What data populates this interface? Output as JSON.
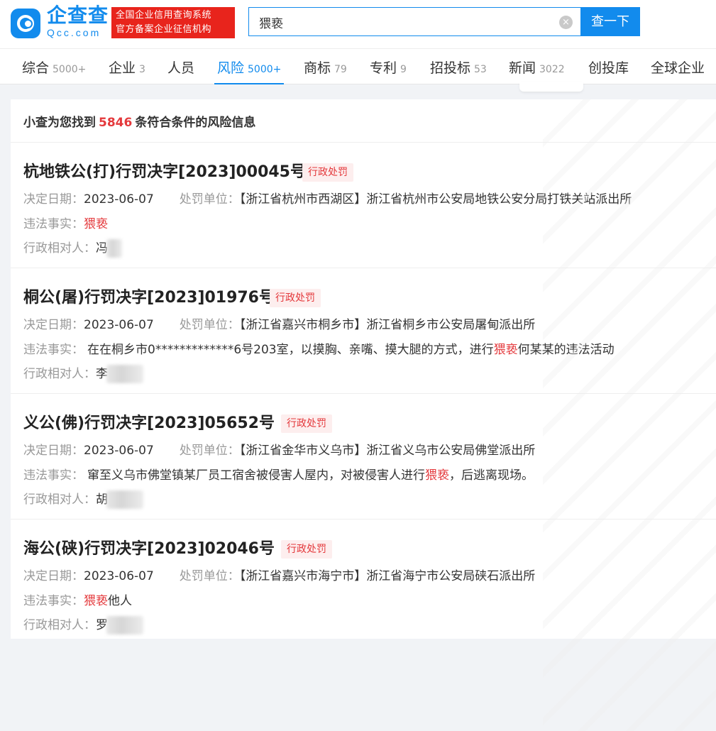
{
  "header": {
    "logo_name": "企查查",
    "logo_domain": "Qcc.com",
    "slogan_line1": "全国企业信用查询系统",
    "slogan_line2": "官方备案企业征信机构",
    "search_value": "猥亵",
    "search_button": "查一下",
    "clear_icon": "×"
  },
  "tabs": [
    {
      "label": "综合",
      "count": "5000+"
    },
    {
      "label": "企业",
      "count": "3"
    },
    {
      "label": "人员",
      "count": ""
    },
    {
      "label": "风险",
      "count": "5000+"
    },
    {
      "label": "商标",
      "count": "79"
    },
    {
      "label": "专利",
      "count": "9"
    },
    {
      "label": "招投标",
      "count": "53"
    },
    {
      "label": "新闻",
      "count": "3022"
    },
    {
      "label": "创投库",
      "count": ""
    },
    {
      "label": "全球企业",
      "count": ""
    }
  ],
  "summary": {
    "prefix": "小查为您找到",
    "count": "5846",
    "suffix": "条符合条件的风险信息"
  },
  "labels": {
    "date": "决定日期：",
    "unit": "处罚单位：",
    "fact": "违法事实：",
    "person": "行政相对人："
  },
  "records": [
    {
      "title": "杭地铁公(打)行罚决字[2023]00045号",
      "tag": "行政处罚",
      "date": "2023-06-07",
      "unit": "【浙江省杭州市西湖区】浙江省杭州市公安局地铁公安分局打铁关站派出所",
      "fact_before": "",
      "fact_hl": "猥亵",
      "fact_after": "",
      "person": "冯"
    },
    {
      "title": "桐公(屠)行罚决字[2023]01976号",
      "tag": "行政处罚",
      "date": "2023-06-07",
      "unit": "【浙江省嘉兴市桐乡市】浙江省桐乡市公安局屠甸派出所",
      "fact_before": "在在桐乡市0*************6号203室，以摸胸、亲嘴、摸大腿的方式，进行",
      "fact_hl": "猥亵",
      "fact_after": "何某某的违法活动",
      "person": "李"
    },
    {
      "title": "义公(佛)行罚决字[2023]05652号",
      "tag": "行政处罚",
      "date": "2023-06-07",
      "unit": "【浙江省金华市义乌市】浙江省义乌市公安局佛堂派出所",
      "fact_before": "窜至义乌市佛堂镇某厂员工宿舍被侵害人屋内，对被侵害人进行",
      "fact_hl": "猥亵",
      "fact_after": "，后逃离现场。",
      "person": "胡"
    },
    {
      "title": "海公(硖)行罚决字[2023]02046号",
      "tag": "行政处罚",
      "date": "2023-06-07",
      "unit": "【浙江省嘉兴市海宁市】浙江省海宁市公安局硖石派出所",
      "fact_before": "",
      "fact_hl": "猥亵",
      "fact_after": "他人",
      "person": "罗"
    }
  ]
}
